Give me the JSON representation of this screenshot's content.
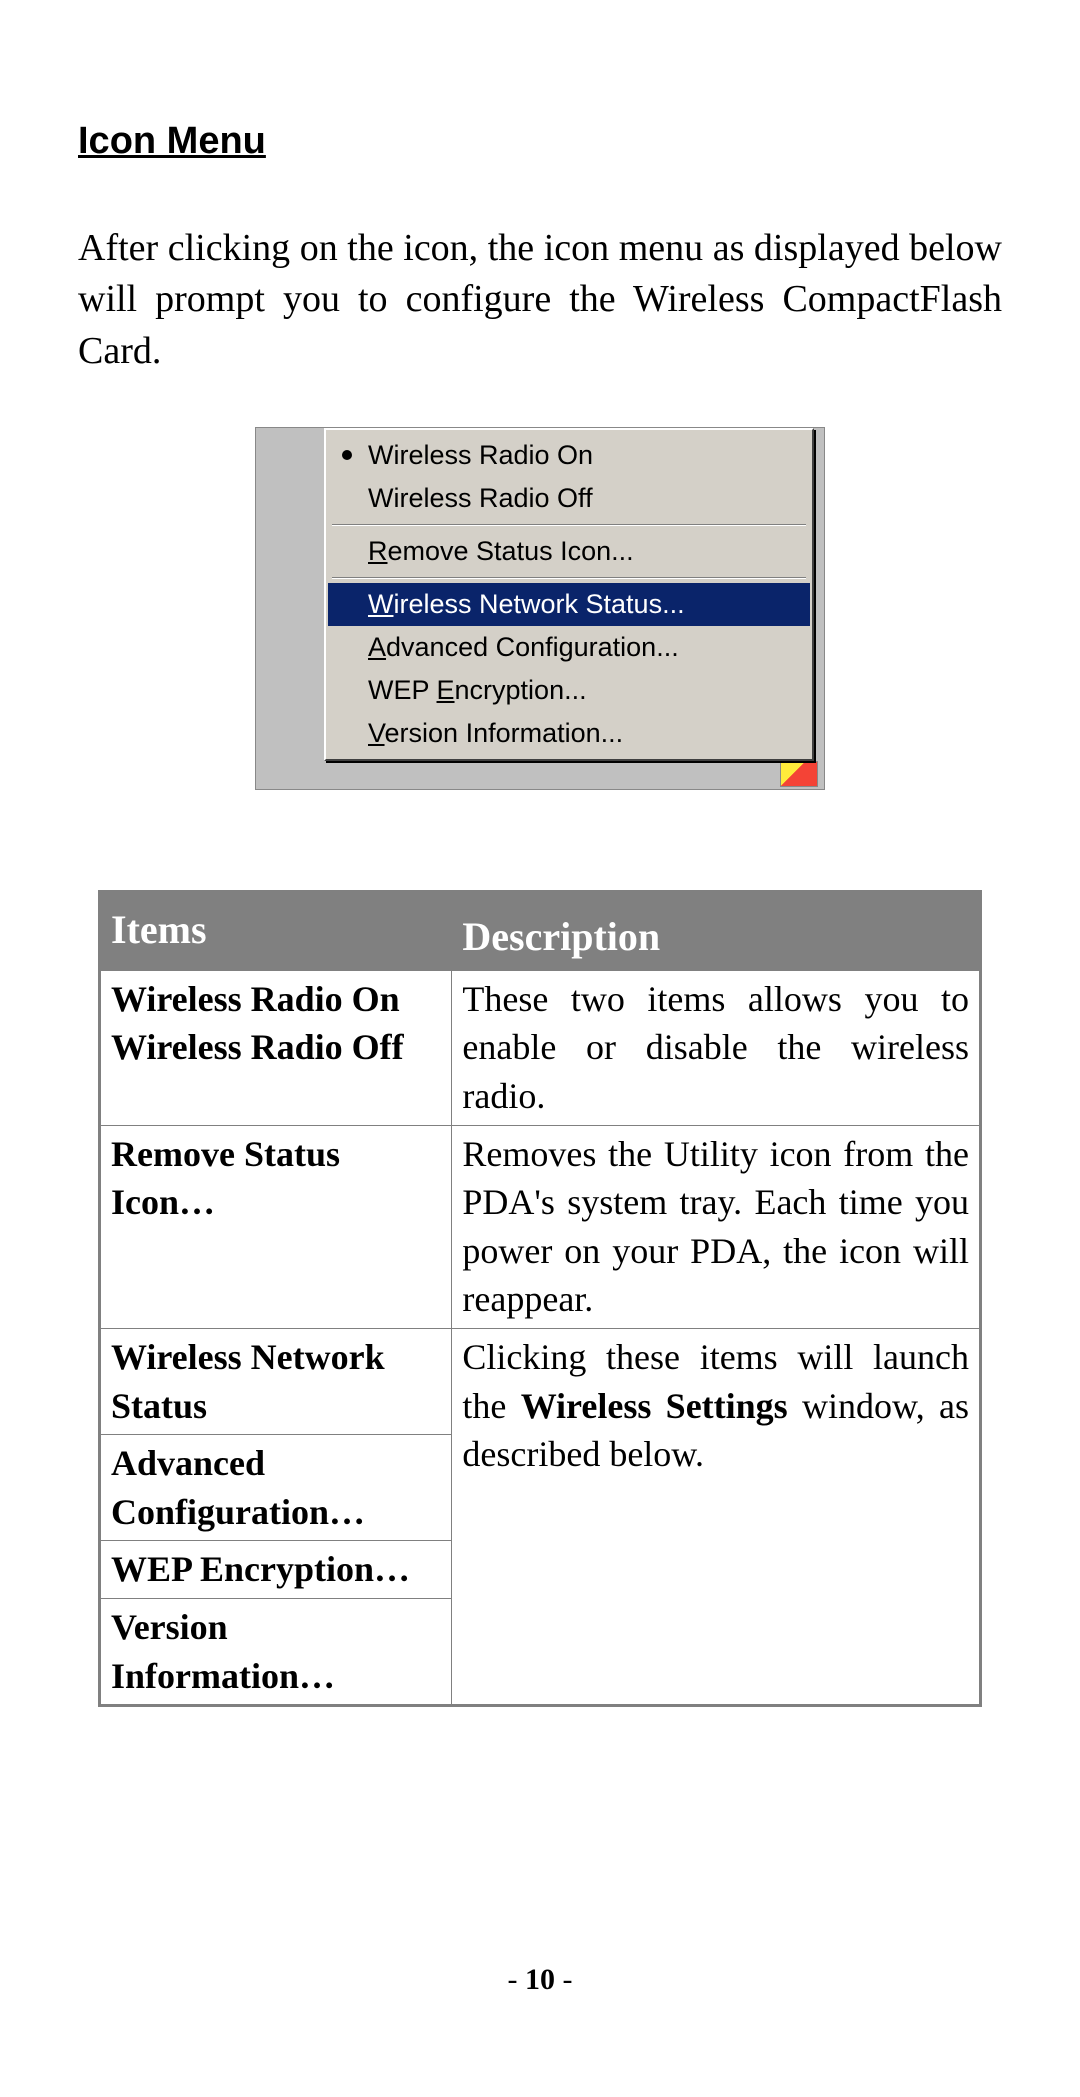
{
  "heading": "Icon Menu",
  "intro": "After clicking on the icon, the icon menu as displayed below will prompt you to configure the Wireless CompactFlash Card.",
  "menu": {
    "items": [
      {
        "prefix": "",
        "accel": "",
        "rest": "Wireless Radio On",
        "bullet": true,
        "selected": false
      },
      {
        "prefix": "",
        "accel": "",
        "rest": "Wireless Radio Off",
        "bullet": false,
        "selected": false
      },
      {
        "sep": true
      },
      {
        "prefix": "",
        "accel": "R",
        "rest": "emove Status Icon...",
        "bullet": false,
        "selected": false
      },
      {
        "sep": true
      },
      {
        "prefix": "",
        "accel": "W",
        "rest": "ireless Network Status...",
        "bullet": false,
        "selected": true
      },
      {
        "prefix": "",
        "accel": "A",
        "rest": "dvanced Configuration...",
        "bullet": false,
        "selected": false
      },
      {
        "prefix": "WEP ",
        "accel": "E",
        "rest": "ncryption...",
        "bullet": false,
        "selected": false
      },
      {
        "prefix": "",
        "accel": "V",
        "rest": "ersion Information...",
        "bullet": false,
        "selected": false
      }
    ]
  },
  "table": {
    "headers": {
      "items": "Items",
      "description": "Description"
    },
    "rows": [
      {
        "items_lines": [
          "Wireless Radio On",
          "Wireless Radio Off"
        ],
        "desc_plain_before": "These two items allows you to enable or disable the wireless radio.",
        "desc_bold": "",
        "desc_plain_after": "",
        "row_span_items": 1
      },
      {
        "items_lines": [
          "Remove Status Icon…"
        ],
        "desc_plain_before": "Removes the Utility icon from the PDA's system tray. Each time you power on your PDA, the icon will reappear.",
        "desc_bold": "",
        "desc_plain_after": "",
        "row_span_items": 1
      },
      {
        "items_lines": [
          "Wireless Network Status"
        ],
        "desc_plain_before": "Clicking these items will launch the ",
        "desc_bold": "Wireless Settings",
        "desc_plain_after": " window, as described below.",
        "row_span_items": 4,
        "merged_items": [
          "Wireless Network Status",
          "Advanced Configuration…",
          "WEP Encryption…",
          "Version Information…"
        ]
      }
    ]
  },
  "page_number": "10"
}
